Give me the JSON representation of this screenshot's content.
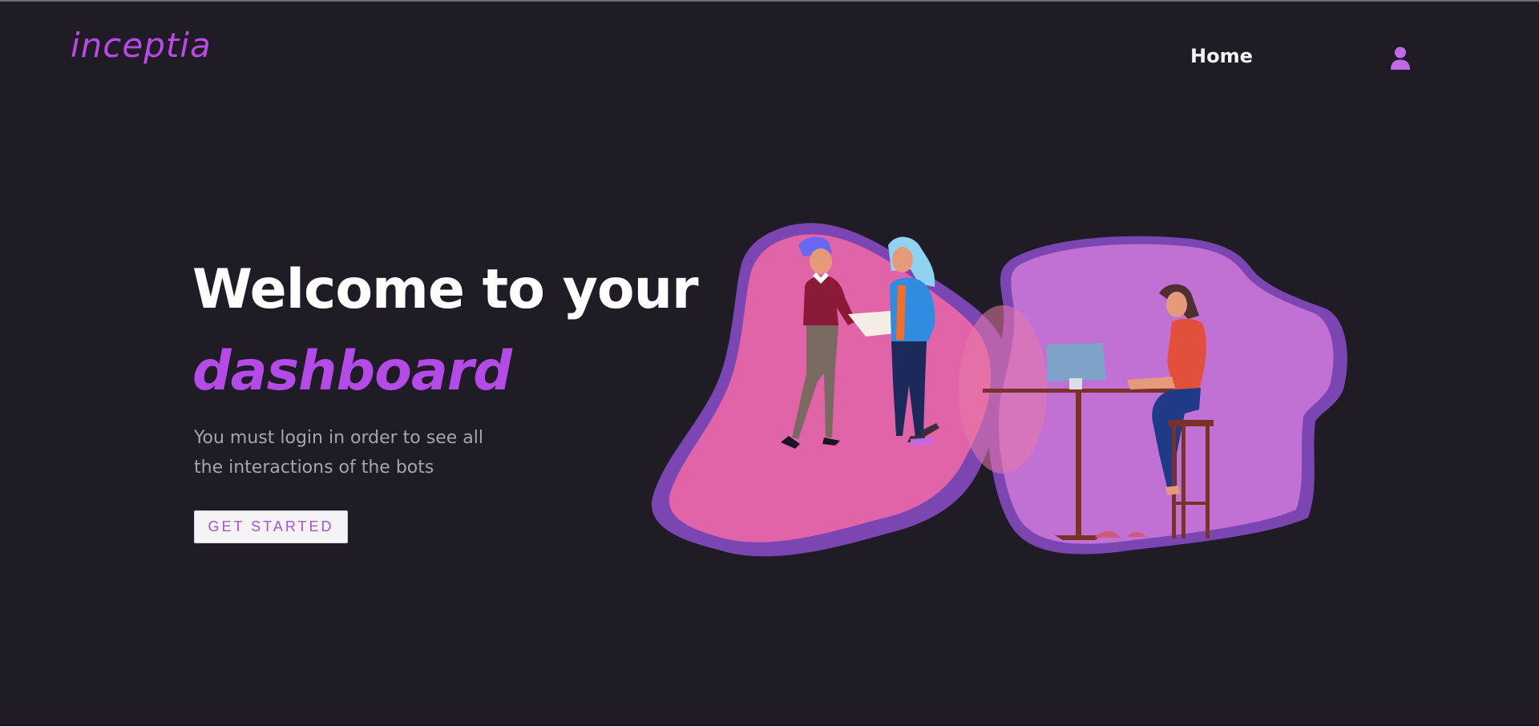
{
  "header": {
    "logo_text": "inceptia",
    "nav_home_label": "Home",
    "user_icon": "user-icon"
  },
  "hero": {
    "title_line1": "Welcome to your",
    "title_accent": "dashboard",
    "description": "You must login in order to see all the interactions of the bots",
    "cta_label": "GET STARTED"
  },
  "illustration": {
    "name": "team-working-illustration"
  },
  "colors": {
    "background": "#1f1c25",
    "accent": "#b44be8",
    "text_primary": "#ffffff",
    "text_muted": "#a7a4ad",
    "blob_pink": "#e164a8",
    "blob_violet": "#c170d4"
  }
}
